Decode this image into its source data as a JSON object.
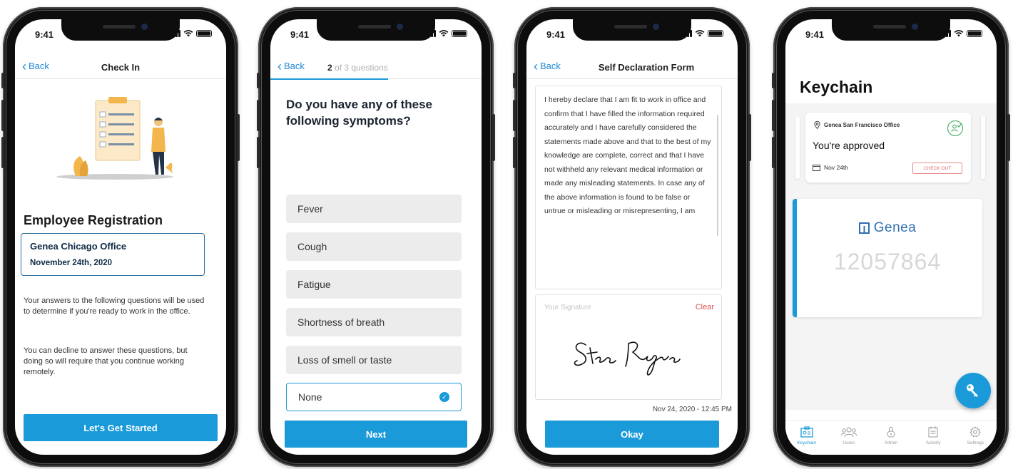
{
  "status": {
    "time": "9:41"
  },
  "screen1": {
    "back_label": "Back",
    "title": "Check In",
    "heading": "Employee Registration",
    "office_name": "Genea Chicago Office",
    "date": "November 24th, 2020",
    "paragraph1": "Your answers to the following questions will be used to determine if you're ready to work in the office.",
    "paragraph2": "You can decline to answer these questions, but doing so will require that you continue working remotely.",
    "button": "Let's Get Started"
  },
  "screen2": {
    "back_label": "Back",
    "progress_current": "2",
    "progress_suffix": "of 3 questions",
    "question": "Do you have any of these following symptoms?",
    "options": [
      "Fever",
      "Cough",
      "Fatigue",
      "Shortness of breath",
      "Loss of smell or taste",
      "None"
    ],
    "selected": "None",
    "button": "Next"
  },
  "screen3": {
    "back_label": "Back",
    "title": "Self Declaration Form",
    "declaration": "I hereby declare that I am fit to work in office and confirm that I have filled the information required accurately and I have carefully considered the statements made above and that to the best of my knowledge are complete, correct and that I have not withheld any relevant medical information or made any misleading statements. In case any of the above information is found to be false or untrue or misleading or misrepresenting, I am",
    "signature_placeholder": "Your Signature",
    "clear_label": "Clear",
    "signature_name": "Steve Rogers",
    "timestamp": "Nov 24, 2020 - 12:45 PM",
    "button": "Okay"
  },
  "screen4": {
    "title": "Keychain",
    "location": "Genea San Francisco Office",
    "approved_text": "You're approved",
    "date": "Nov 24th",
    "checkout_label": "CHECK OUT",
    "brand": "Genea",
    "card_number": "12057864",
    "tabs": [
      "Keychain",
      "Users",
      "Admin",
      "Activity",
      "Settings"
    ],
    "active_tab": "Keychain",
    "accent": "#1a9ad9"
  }
}
